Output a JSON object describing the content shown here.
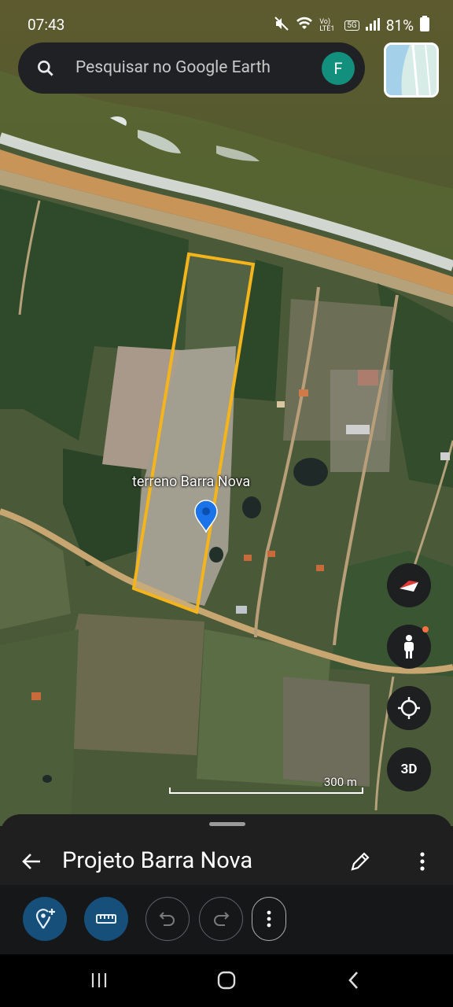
{
  "status_bar": {
    "time": "07:43",
    "network": "Vo) LTE1",
    "signal_label": "5G",
    "battery": "81%"
  },
  "search": {
    "placeholder": "Pesquisar no Google Earth",
    "avatar_letter": "F"
  },
  "map": {
    "place_label": "terreno Barra Nova",
    "scale_label": "300 m",
    "controls": [
      "compass-icon",
      "street-view-icon",
      "my-location-icon",
      "3D"
    ],
    "three_d_label": "3D"
  },
  "project": {
    "title": "Projeto Barra Nova"
  },
  "toolbar": {
    "buttons": [
      "add-placemark-icon",
      "measure-icon",
      "undo-icon",
      "redo-icon",
      "more-icon"
    ]
  },
  "nav": [
    "recent-apps-icon",
    "home-icon",
    "back-icon"
  ],
  "colors": {
    "outline": "#f3b51b",
    "pin": "#1a73e8",
    "avatar": "#12907d",
    "primary_button": "#174f7b"
  }
}
